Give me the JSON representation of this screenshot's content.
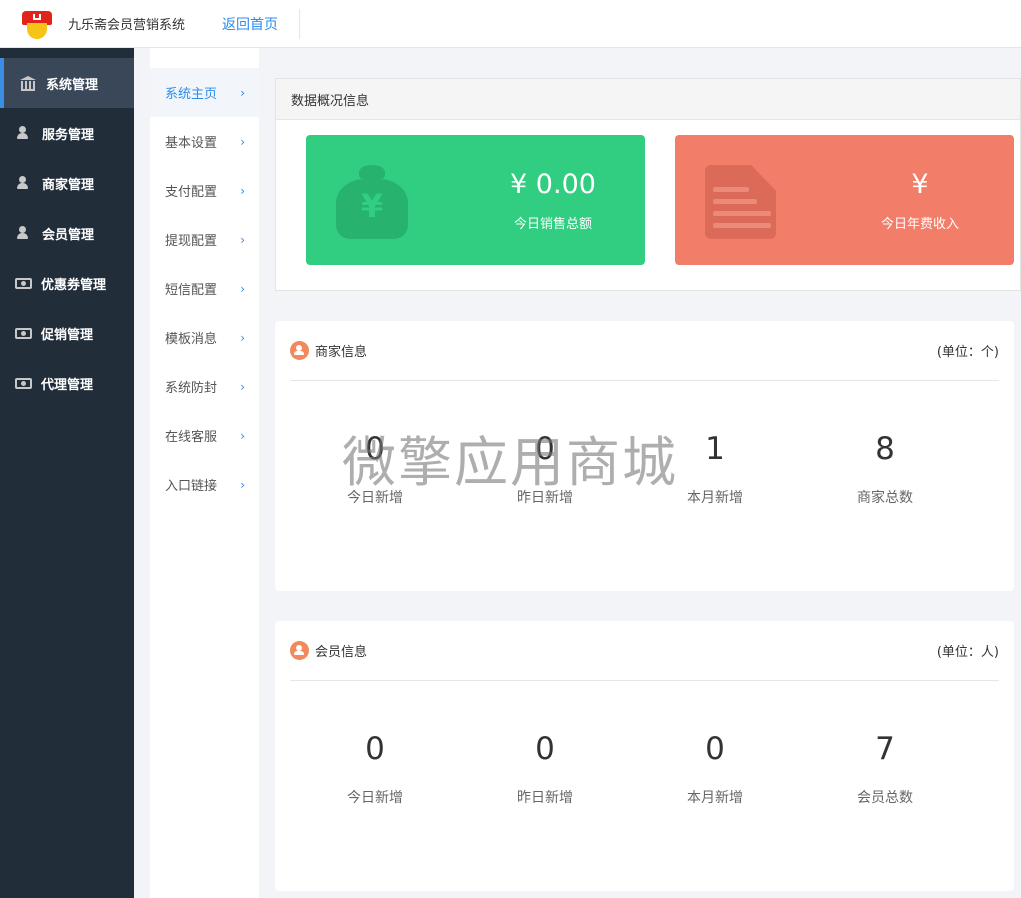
{
  "header": {
    "app_title": "九乐斋会员营销系统",
    "back_home": "返回首页"
  },
  "sidebar": {
    "items": [
      {
        "label": "系统管理",
        "icon": "bank-icon"
      },
      {
        "label": "服务管理",
        "icon": "user-icon"
      },
      {
        "label": "商家管理",
        "icon": "user-icon"
      },
      {
        "label": "会员管理",
        "icon": "user-icon"
      },
      {
        "label": "优惠券管理",
        "icon": "money-icon"
      },
      {
        "label": "促销管理",
        "icon": "money-icon"
      },
      {
        "label": "代理管理",
        "icon": "money-icon"
      }
    ]
  },
  "submenu": {
    "items": [
      {
        "label": "系统主页"
      },
      {
        "label": "基本设置"
      },
      {
        "label": "支付配置"
      },
      {
        "label": "提现配置"
      },
      {
        "label": "短信配置"
      },
      {
        "label": "模板消息"
      },
      {
        "label": "系统防封"
      },
      {
        "label": "在线客服"
      },
      {
        "label": "入口链接"
      }
    ],
    "chevron": "›"
  },
  "overview": {
    "title": "数据概况信息",
    "sales": {
      "value": "¥ 0.00",
      "label": "今日销售总额",
      "icon": "money-bag-icon",
      "color": "#31cd80"
    },
    "fee": {
      "value": "¥",
      "label": "今日年费收入",
      "icon": "document-icon",
      "color": "#f27d68"
    }
  },
  "merchant_info": {
    "title": "商家信息",
    "unit": "(单位：个)",
    "stats": [
      {
        "value": "0",
        "label": "今日新增"
      },
      {
        "value": "0",
        "label": "昨日新增"
      },
      {
        "value": "1",
        "label": "本月新增"
      },
      {
        "value": "8",
        "label": "商家总数"
      }
    ]
  },
  "member_info": {
    "title": "会员信息",
    "unit": "(单位：人)",
    "stats": [
      {
        "value": "0",
        "label": "今日新增"
      },
      {
        "value": "0",
        "label": "昨日新增"
      },
      {
        "value": "0",
        "label": "本月新增"
      },
      {
        "value": "7",
        "label": "会员总数"
      }
    ]
  },
  "watermark": "微擎应用商城"
}
